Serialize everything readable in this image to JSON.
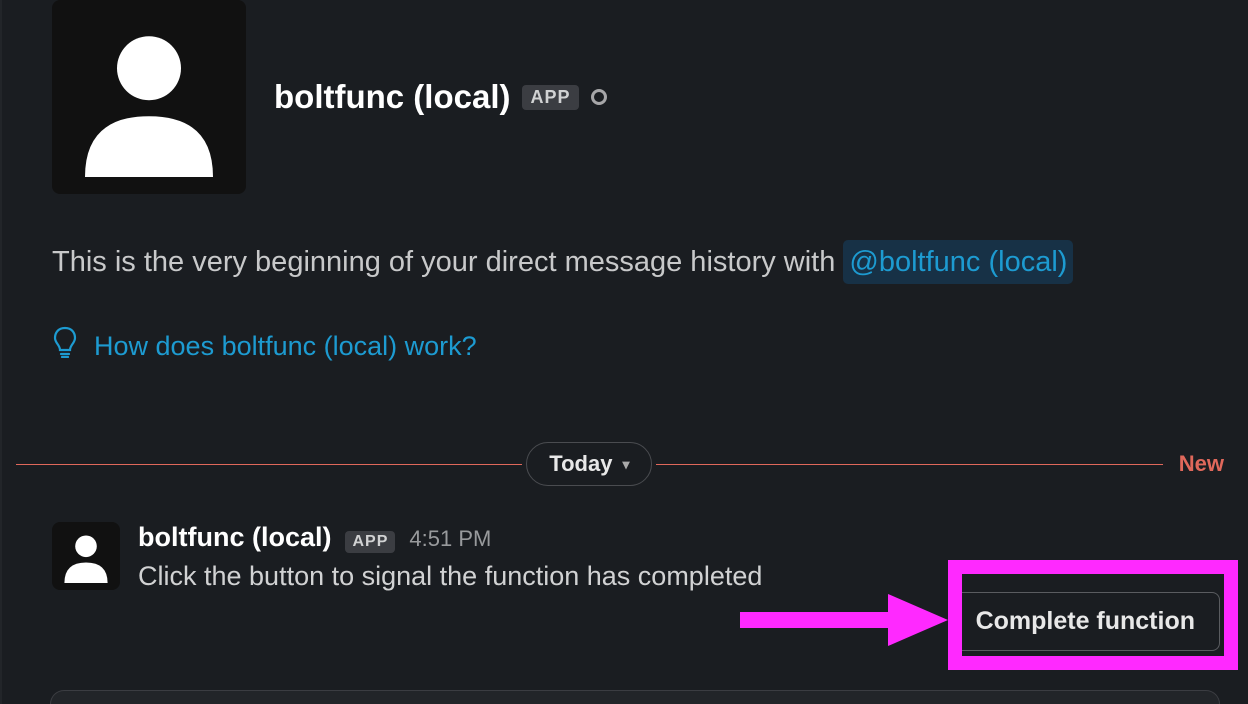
{
  "profile": {
    "name": "boltfunc (local)",
    "badge": "APP"
  },
  "intro": {
    "prefix": "This is the very beginning of your direct message history with ",
    "mention": "@boltfunc (local)"
  },
  "help": {
    "link_text": "How does boltfunc (local) work?"
  },
  "divider": {
    "label": "Today",
    "new_label": "New"
  },
  "message": {
    "user": "boltfunc (local)",
    "badge": "APP",
    "time": "4:51 PM",
    "text": "Click the button to signal the function has completed",
    "button": "Complete function"
  }
}
